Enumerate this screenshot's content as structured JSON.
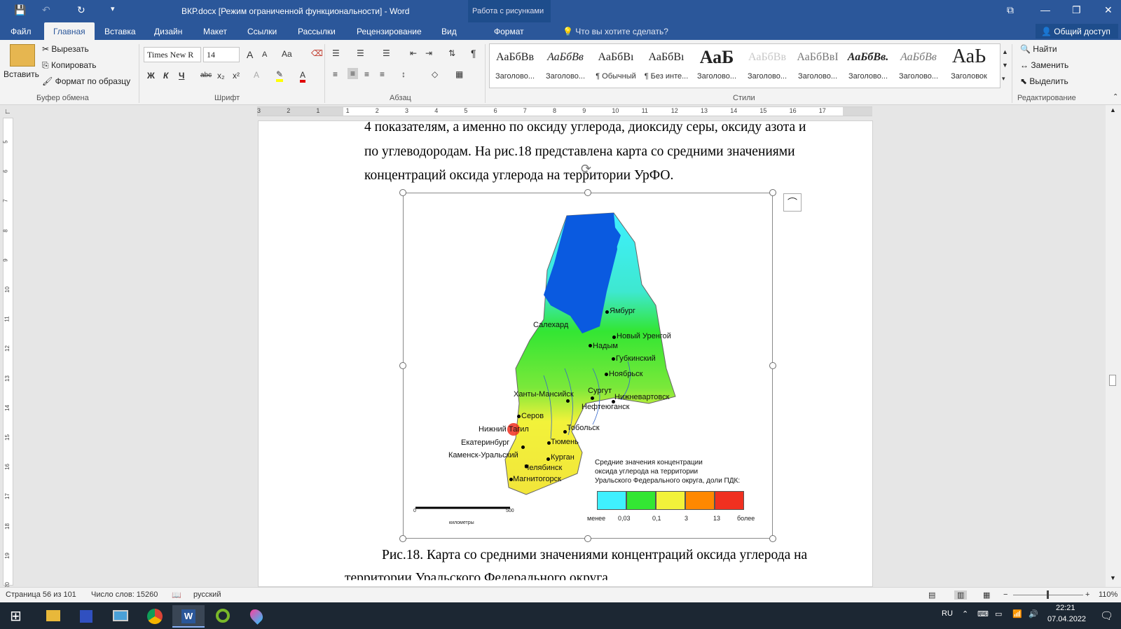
{
  "window": {
    "title": "ВКР.docx [Режим ограниченной функциональности] - Word",
    "context_tab_group": "Работа с рисунками"
  },
  "tabs": [
    "Файл",
    "Главная",
    "Вставка",
    "Дизайн",
    "Макет",
    "Ссылки",
    "Рассылки",
    "Рецензирование",
    "Вид",
    "Формат"
  ],
  "tell_me": "Что вы хотите сделать?",
  "share": "Общий доступ",
  "clipboard": {
    "paste": "Вставить",
    "cut": "Вырезать",
    "copy": "Копировать",
    "format_painter": "Формат по образцу",
    "group": "Буфер обмена"
  },
  "font": {
    "name": "Times New R",
    "size": "14",
    "group": "Шрифт",
    "bold": "Ж",
    "italic": "К",
    "underline": "Ч",
    "strike": "abc",
    "sub": "x₂",
    "sup": "x²",
    "grow": "A",
    "shrink": "A",
    "case": "Aa"
  },
  "paragraph": {
    "group": "Абзац",
    "pilcrow": "¶"
  },
  "styles": {
    "group": "Стили",
    "items": [
      {
        "preview": "АаБбВв",
        "name": "Заголово..."
      },
      {
        "preview": "АаБбВв",
        "name": "Заголово..."
      },
      {
        "preview": "АаБбВı",
        "name": "¶ Обычный"
      },
      {
        "preview": "АаБбВı",
        "name": "¶ Без инте..."
      },
      {
        "preview": "АаБ",
        "name": "Заголово..."
      },
      {
        "preview": "АаБбВв",
        "name": "Заголово..."
      },
      {
        "preview": "АаБбВвІ",
        "name": "Заголово..."
      },
      {
        "preview": "АаБбВв.",
        "name": "Заголово..."
      },
      {
        "preview": "АаБбВв",
        "name": "Заголово..."
      },
      {
        "preview": "АаЬ",
        "name": "Заголовок"
      }
    ]
  },
  "editing": {
    "group": "Редактирование",
    "find": "Найти",
    "replace": "Заменить",
    "select": "Выделить"
  },
  "ruler": {
    "h_numbers": [
      "3",
      "2",
      "1",
      "1",
      "2",
      "3",
      "4",
      "5",
      "6",
      "7",
      "8",
      "9",
      "10",
      "11",
      "12",
      "13",
      "14",
      "15",
      "16",
      "17"
    ],
    "v_numbers": [
      "5",
      "6",
      "7",
      "8",
      "9",
      "10",
      "11",
      "12",
      "13",
      "14",
      "15",
      "16",
      "17",
      "18",
      "19",
      "20"
    ]
  },
  "document": {
    "line1": "4 показателям, а именно по оксиду углерода, диоксиду серы, оксиду азота и",
    "line2": "по углеводородам.  На рис.18 представлена карта со средними значениями",
    "line3": "концентраций оксида углерода на территории УрФО.",
    "caption1": "Рис.18. Карта со средними значениями концентраций оксида углерода на",
    "caption2": "территории Уральского Федерального округа."
  },
  "map": {
    "cities": [
      "Ямбург",
      "Салехард",
      "Новый Уренгой",
      "Надым",
      "Губкинский",
      "Ноябрьск",
      "Ханты-Мансийск",
      "Сургут",
      "Нижневартовск",
      "Нефтеюганск",
      "Серов",
      "Нижний Тагил",
      "Тобольск",
      "Екатеринбург",
      "Тюмень",
      "Каменск-Уральский",
      "Курган",
      "Челябинск",
      "Магнитогорск"
    ],
    "legend_title": [
      "Средние значения концентрации",
      "оксида углерода на территории",
      "Уральского Федерального округа, доли ПДК:"
    ],
    "legend_colors": [
      "#3ff0ff",
      "#33e633",
      "#f2f23a",
      "#ff8800",
      "#f03020"
    ],
    "legend_ticks": [
      "менее",
      "0,03",
      "0,1",
      "3",
      "13",
      "более"
    ],
    "scale_labels": [
      "0",
      "500",
      "километры"
    ]
  },
  "status": {
    "page": "Страница 56 из 101",
    "words": "Число слов: 15260",
    "lang": "русский",
    "zoom": "110%"
  },
  "tray": {
    "lang": "RU",
    "time": "22:21",
    "date": "07.04.2022"
  }
}
